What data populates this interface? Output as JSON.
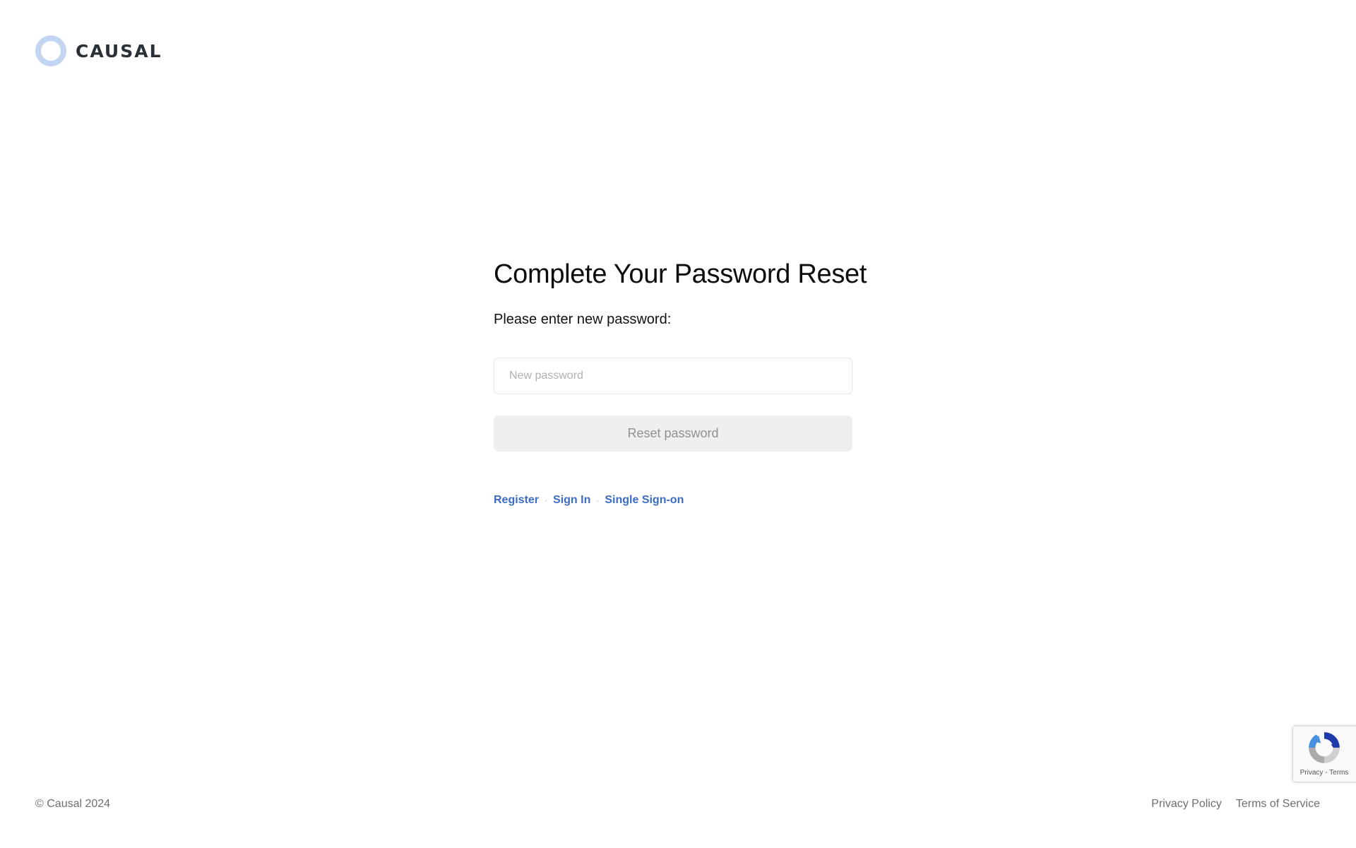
{
  "header": {
    "logo_text": "CAUSAL",
    "logo_mark_color": "#c3d5f1"
  },
  "form": {
    "title": "Complete Your Password Reset",
    "subtitle": "Please enter new password:",
    "password_placeholder": "New password",
    "password_value": "",
    "submit_label": "Reset password",
    "submit_disabled": true
  },
  "links": {
    "register": "Register",
    "separator_1": "·",
    "sign_in": "Sign In",
    "separator_2": "·",
    "sso": "Single Sign-on",
    "link_color": "#3b6cc4"
  },
  "footer": {
    "copyright": "© Causal 2024",
    "privacy": "Privacy Policy",
    "terms": "Terms of Service"
  },
  "recaptcha": {
    "icon": "recaptcha-icon",
    "privacy": "Privacy",
    "separator": "-",
    "terms": "Terms"
  }
}
